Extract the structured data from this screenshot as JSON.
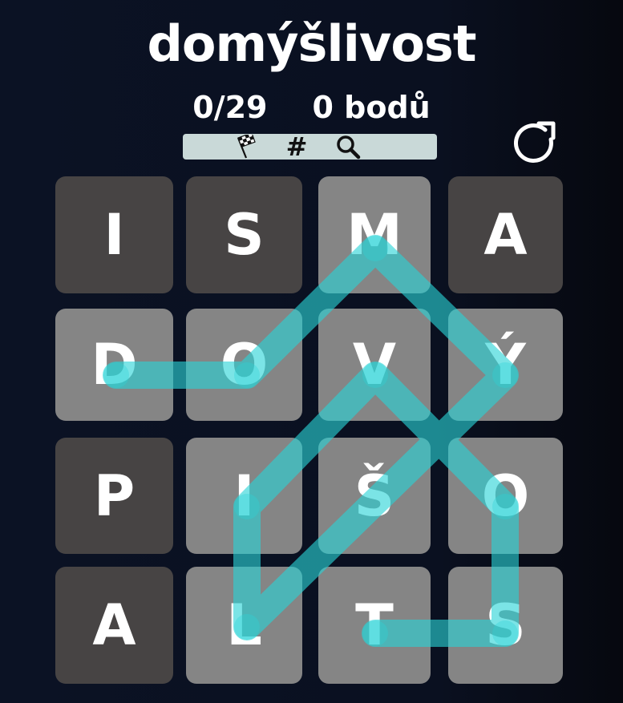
{
  "game": {
    "title": "domýšlivost",
    "progress": "0/29",
    "score": "0 bodů"
  },
  "toolbar": {
    "icons": [
      "checkered-flag-icon",
      "hash-icon",
      "magnifier-icon"
    ],
    "hash_label": "#"
  },
  "colors": {
    "tile_dark": "#474444",
    "tile_light": "#858585",
    "path": "#2ad3d6",
    "toolbar_bg": "#c9d9d8"
  },
  "grid": {
    "rows": 4,
    "cols": 4,
    "letters": [
      [
        "I",
        "S",
        "M",
        "A"
      ],
      [
        "D",
        "O",
        "V",
        "Ý"
      ],
      [
        "P",
        "I",
        "Š",
        "O"
      ],
      [
        "A",
        "L",
        "T",
        "S"
      ]
    ],
    "used": [
      [
        false,
        false,
        true,
        false
      ],
      [
        true,
        true,
        true,
        true
      ],
      [
        false,
        true,
        true,
        true
      ],
      [
        false,
        true,
        true,
        true
      ]
    ]
  },
  "selected_path": [
    [
      1,
      0
    ],
    [
      1,
      1
    ],
    [
      0,
      2
    ],
    [
      1,
      3
    ],
    [
      3,
      1
    ],
    [
      2,
      1
    ],
    [
      1,
      2
    ],
    [
      2,
      3
    ],
    [
      3,
      3
    ],
    [
      3,
      2
    ]
  ]
}
